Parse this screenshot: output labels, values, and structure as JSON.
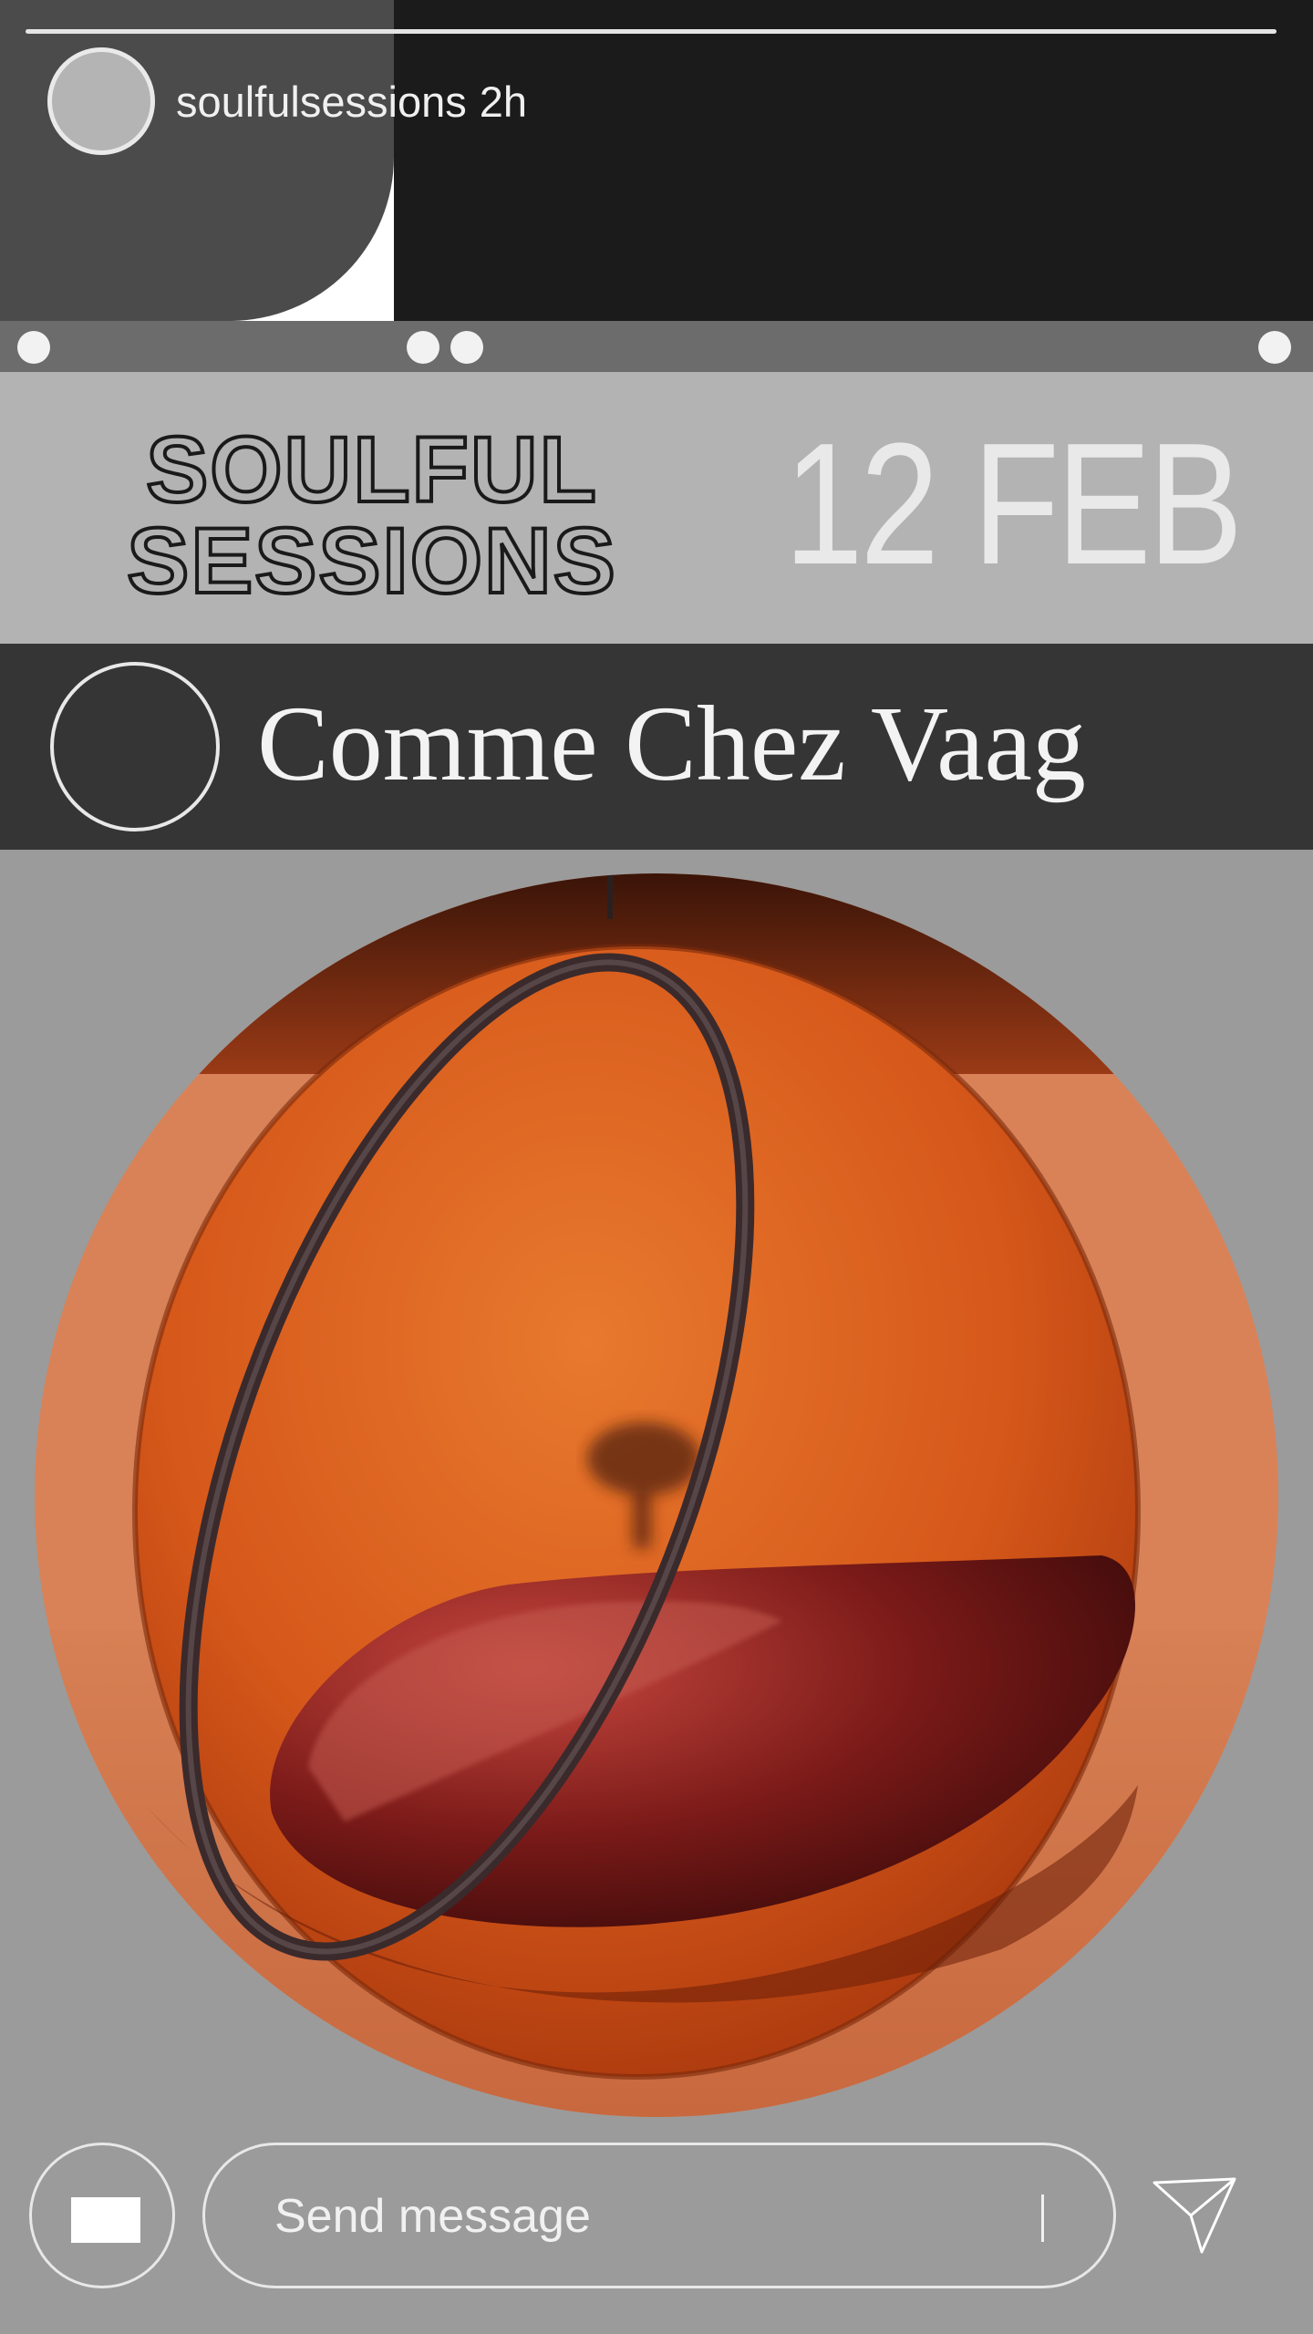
{
  "story": {
    "username": "soulfulsessions",
    "age": "2h"
  },
  "event": {
    "logo_line1": "SOULFUL",
    "logo_line2": "SESSIONS",
    "date": "12 FEB",
    "venue": "Comme Chez Vaag"
  },
  "composer": {
    "placeholder": "Send message"
  },
  "icons": {
    "camera": "camera-icon",
    "send": "send-icon"
  },
  "colors": {
    "header_bg": "#1b1b1b",
    "title_band_bg": "#b3b3b3",
    "venue_band_bg": "#353535",
    "page_bg": "#9b9b9b",
    "art_orange": "#d9621c"
  }
}
